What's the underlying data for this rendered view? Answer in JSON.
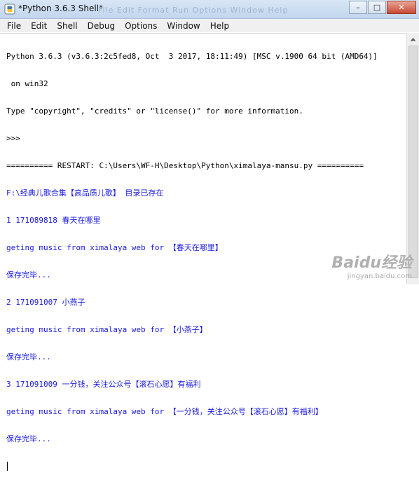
{
  "window": {
    "title": "*Python 3.6.3 Shell*",
    "ghost_menu": "File  Edit  Format  Run  Options  Window  Help",
    "buttons": [
      "–",
      "□",
      "✕"
    ]
  },
  "menubar": {
    "items": [
      "File",
      "Edit",
      "Shell",
      "Debug",
      "Options",
      "Window",
      "Help"
    ]
  },
  "shell": {
    "lines": [
      {
        "text": "Python 3.6.3 (v3.6.3:2c5fed8, Oct  3 2017, 18:11:49) [MSC v.1900 64 bit (AMD64)]",
        "color": "black"
      },
      {
        "text": " on win32",
        "color": "black"
      },
      {
        "text": "Type \"copyright\", \"credits\" or \"license()\" for more information.",
        "color": "black"
      },
      {
        "text": ">>> ",
        "color": "black"
      },
      {
        "text": "========== RESTART: C:\\Users\\WF-H\\Desktop\\Python\\ximalaya-mansu.py ==========",
        "color": "black"
      },
      {
        "text": "F:\\经典儿歌合集【高品质儿歌】 目录已存在",
        "color": "blue"
      },
      {
        "text": "1 171089818 春天在哪里",
        "color": "blue"
      },
      {
        "text": "geting music from ximalaya web for 【春天在哪里】",
        "color": "blue"
      },
      {
        "text": "保存完毕...",
        "color": "blue"
      },
      {
        "text": "2 171091007 小燕子",
        "color": "blue"
      },
      {
        "text": "geting music from ximalaya web for 【小燕子】",
        "color": "blue"
      },
      {
        "text": "保存完毕...",
        "color": "blue"
      },
      {
        "text": "3 171091009 一分钱，关注公众号【滚石心愿】有福利",
        "color": "blue"
      },
      {
        "text": "geting music from ximalaya web for 【一分钱，关注公众号【滚石心愿】有福利】",
        "color": "blue"
      },
      {
        "text": "保存完毕...",
        "color": "blue"
      }
    ]
  },
  "watermark": {
    "logo": "Baidu经验",
    "url": "jingyan.baidu.com"
  },
  "colors": {
    "output_blue": "#1a1adc",
    "text_black": "#000000"
  }
}
